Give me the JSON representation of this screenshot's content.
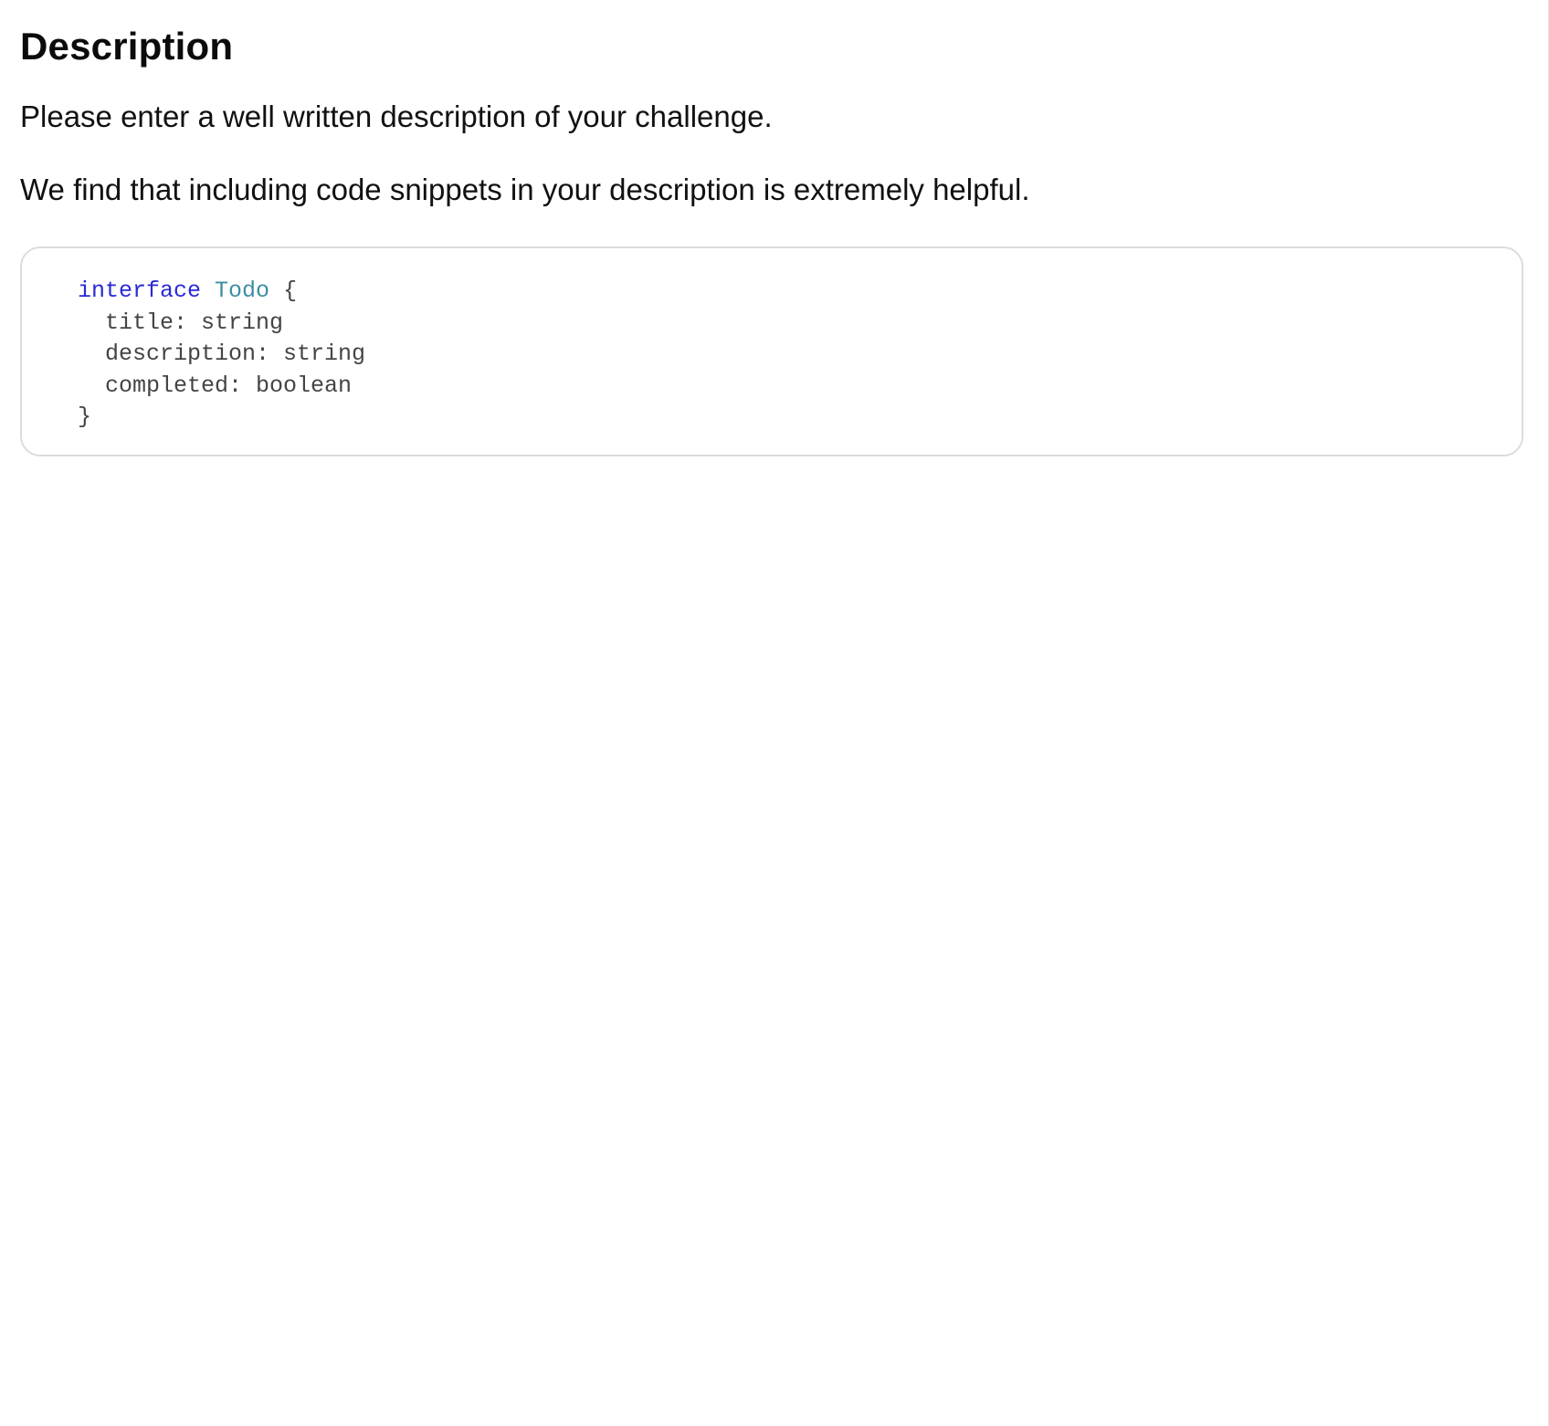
{
  "heading": "Description",
  "paragraphs": {
    "first": "Please enter a well written description of your challenge.",
    "second": "We find that including code snippets in your description is extremely helpful."
  },
  "code_snippet": {
    "language": "typescript",
    "keyword": "interface",
    "type_name": "Todo",
    "open_brace": "{",
    "fields": [
      "  title: string",
      "  description: string",
      "  completed: boolean"
    ],
    "close_brace": "}"
  },
  "colors": {
    "keyword": "#2a2ad6",
    "type_name": "#3d8fa3",
    "code_text": "#444444",
    "border": "#dcdcdc"
  }
}
